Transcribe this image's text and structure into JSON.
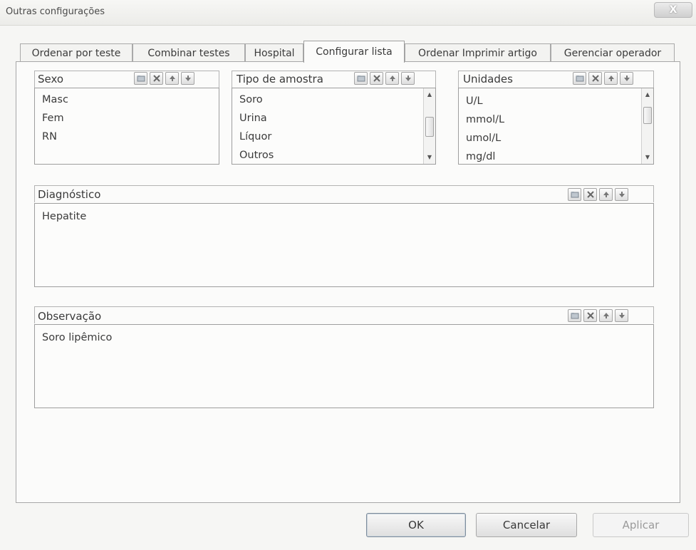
{
  "window": {
    "title": "Outras configurações",
    "close_label": "X"
  },
  "tabs": [
    {
      "label": "Ordenar por teste"
    },
    {
      "label": "Combinar testes"
    },
    {
      "label": "Hospital"
    },
    {
      "label": "Configurar lista",
      "active": true
    },
    {
      "label": "Ordenar Imprimir artigo"
    },
    {
      "label": "Gerenciar operador"
    }
  ],
  "sexo": {
    "label": "Sexo",
    "items": [
      "Masc",
      "Fem",
      "RN"
    ]
  },
  "tipo_amostra": {
    "label": "Tipo de amostra",
    "items": [
      "Soro",
      "Urina",
      "Líquor",
      "Outros"
    ]
  },
  "unidades": {
    "label": "Unidades",
    "items": [
      "U/L",
      "mmol/L",
      "umol/L",
      "mg/dl"
    ]
  },
  "diagnostico": {
    "label": "Diagnóstico",
    "items": [
      "Hepatite"
    ]
  },
  "observacao": {
    "label": "Observação",
    "items": [
      "Soro lipêmico"
    ]
  },
  "buttons": {
    "ok": "OK",
    "cancel": "Cancelar",
    "apply": "Aplicar"
  },
  "icons": {
    "add": "folder-add-icon",
    "delete": "delete-x-icon",
    "up": "arrow-up-icon",
    "down": "arrow-down-icon"
  }
}
